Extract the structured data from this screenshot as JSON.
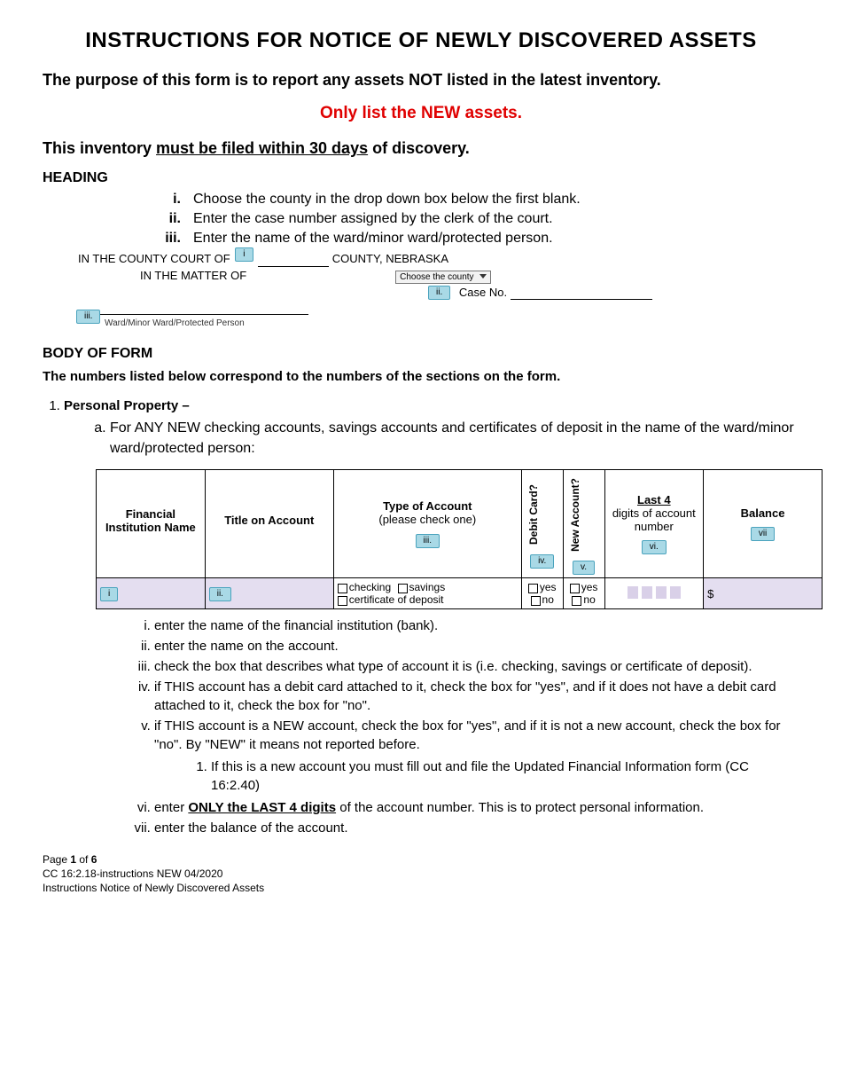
{
  "title": "INSTRUCTIONS FOR NOTICE OF NEWLY DISCOVERED ASSETS",
  "purpose": "The purpose of this form is to report any assets NOT listed in the latest inventory.",
  "redNote": "Only list the NEW assets.",
  "deadline_pre": "This inventory ",
  "deadline_u": "must be filed within 30 days",
  "deadline_post": " of discovery.",
  "heading": {
    "section": "HEADING",
    "items": {
      "i": "Choose the county in the drop down box below the first blank.",
      "ii": "Enter the case number assigned by the clerk of the court.",
      "iii": "Enter the name of the ward/minor ward/protected person."
    },
    "illus": {
      "countyLine_pre": "IN THE  COUNTY  COURT OF ",
      "countyLine_post": " COUNTY, NEBRASKA",
      "dropdown": "Choose the county",
      "matter": "IN THE MATTER OF",
      "caseNo": "Case No.",
      "wardLabel": "Ward/Minor Ward/Protected Person",
      "chips": {
        "i": "i",
        "ii": "ii.",
        "iii": "iii."
      }
    }
  },
  "body": {
    "section": "BODY OF FORM",
    "note": "The numbers listed below correspond to the numbers of the sections on the form.",
    "item1": {
      "label": "Personal Property –",
      "a": "For ANY NEW checking accounts, savings accounts and certificates of deposit in the name of the ward/minor ward/protected person:"
    },
    "table": {
      "h": {
        "fin": "Financial Institution Name",
        "title": "Title on Account",
        "type": "Type of Account",
        "typeSub": "(please check one)",
        "debit": "Debit Card?",
        "newacct": "New Account?",
        "last4_u": "Last 4",
        "last4_rest": "digits of account number",
        "balance": "Balance"
      },
      "chips": {
        "i": "i",
        "ii": "ii.",
        "iii": "iii.",
        "iv": "iv.",
        "v": "v.",
        "vi": "vi.",
        "vii": "vii"
      },
      "row": {
        "checking": "checking",
        "savings": "savings",
        "cod": "certificate of deposit",
        "yes": "yes",
        "no": "no",
        "dollar": "$"
      }
    },
    "defs": {
      "i": "enter the name of the financial institution (bank).",
      "ii": "enter the name on the account.",
      "iii": "check the box that describes what type of account it is (i.e. checking, savings or certificate of deposit).",
      "iv": "if THIS account has a debit card attached to it, check the box for \"yes\", and if it does not have a debit card attached to it, check the box for \"no\".",
      "v": "if THIS account is a NEW account, check the box for \"yes\", and if it is not a new account, check the box for \"no\".  By \"NEW\" it means not reported before.",
      "v1": "If this is a new account you must fill out and file the Updated Financial Information form (CC 16:2.40)",
      "vi_pre": "enter ",
      "vi_b": "ONLY the LAST 4 digits",
      "vi_post": " of the account number.  This is to protect personal information.",
      "vii": "enter the balance of the account."
    }
  },
  "footer": {
    "page_pre": "Page ",
    "page_b": "1",
    "page_post": " of ",
    "page_total": "6",
    "ref": "CC 16:2.18-instructions NEW 04/2020",
    "title": "Instructions Notice of Newly Discovered Assets"
  }
}
